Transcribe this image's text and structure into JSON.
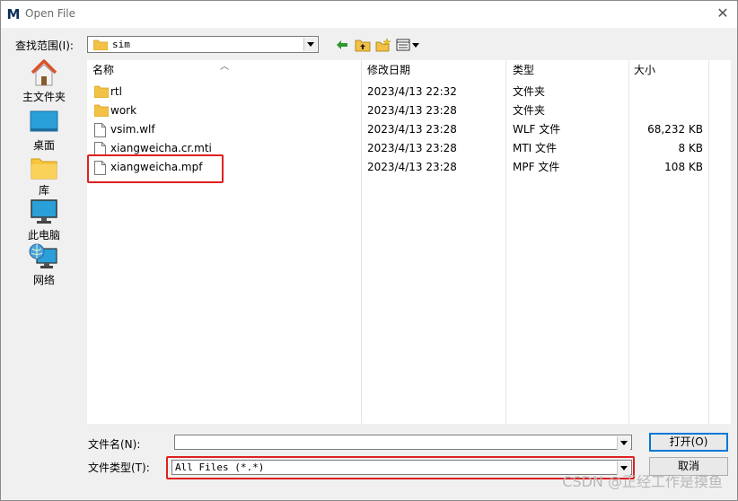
{
  "window": {
    "title": "Open File",
    "app_icon": "M",
    "close_glyph": "✕"
  },
  "look_in": {
    "label": "查找范围(I):",
    "value": "sim"
  },
  "toolbar": {
    "icons": [
      "back-arrow-icon",
      "up-folder-icon",
      "new-folder-icon",
      "view-menu-icon"
    ]
  },
  "places": [
    {
      "label": "主文件夹",
      "icon": "home-icon"
    },
    {
      "label": "桌面",
      "icon": "desktop-icon"
    },
    {
      "label": "库",
      "icon": "library-icon"
    },
    {
      "label": "此电脑",
      "icon": "computer-icon"
    },
    {
      "label": "网络",
      "icon": "network-icon"
    }
  ],
  "columns": {
    "name": "名称",
    "date": "修改日期",
    "type": "类型",
    "size": "大小"
  },
  "files": [
    {
      "name": "rtl",
      "date": "2023/4/13 22:32",
      "type": "文件夹",
      "size": "",
      "icon": "folder-icon"
    },
    {
      "name": "work",
      "date": "2023/4/13 23:28",
      "type": "文件夹",
      "size": "",
      "icon": "folder-icon"
    },
    {
      "name": "vsim.wlf",
      "date": "2023/4/13 23:28",
      "type": "WLF 文件",
      "size": "68,232 KB",
      "icon": "file-icon"
    },
    {
      "name": "xiangweicha.cr.mti",
      "date": "2023/4/13 23:28",
      "type": "MTI 文件",
      "size": "8 KB",
      "icon": "file-icon"
    },
    {
      "name": "xiangweicha.mpf",
      "date": "2023/4/13 23:28",
      "type": "MPF 文件",
      "size": "108 KB",
      "icon": "file-icon"
    }
  ],
  "filename": {
    "label": "文件名(N):",
    "value": ""
  },
  "filetype": {
    "label": "文件类型(T):",
    "value": "All Files (*.*)"
  },
  "buttons": {
    "open": "打开(O)",
    "cancel": "取消"
  },
  "highlight_color": "#e02020",
  "watermark": "CSDN @正经工作是摸鱼"
}
